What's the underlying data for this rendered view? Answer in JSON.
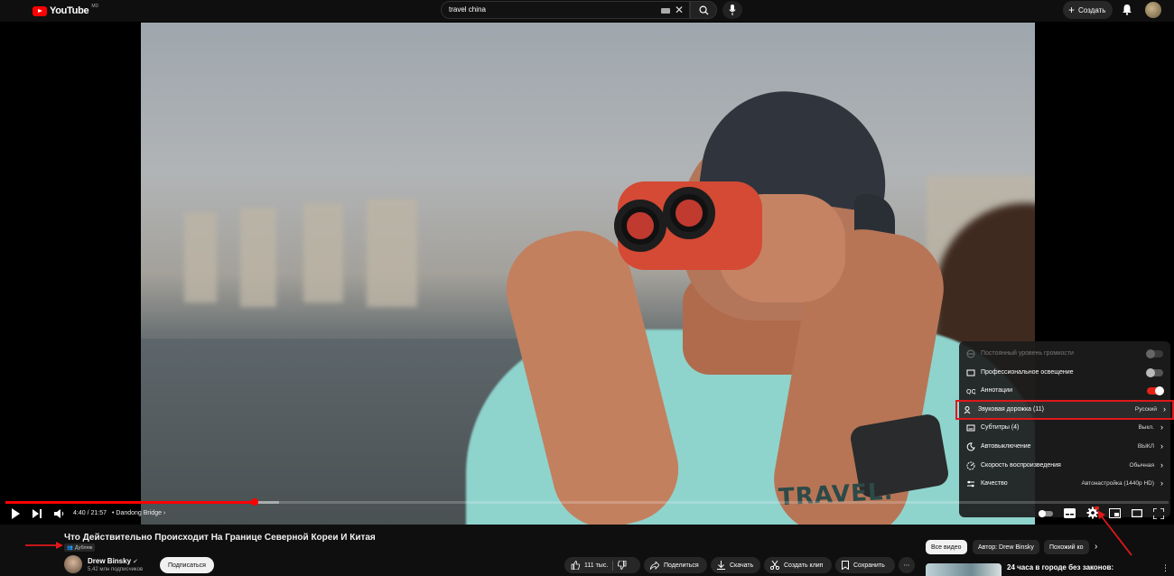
{
  "header": {
    "logo_text": "YouTube",
    "logo_region": "MD",
    "search_query": "travel china",
    "create_label": "Создать"
  },
  "player": {
    "progress_fraction": 0.214,
    "buffered_fraction": 0.235,
    "time_display": "4:40 / 21:57",
    "chapter": "• Dandong Bridge",
    "tee_print": "TRAVEL."
  },
  "settings_menu": {
    "items": [
      {
        "label": "Постоянный уровень громкости",
        "type": "toggle",
        "state": "disabled"
      },
      {
        "label": "Профессиональное освещение",
        "type": "toggle",
        "state": "off"
      },
      {
        "label": "Аннотации",
        "type": "toggle",
        "state": "on"
      },
      {
        "label": "Звуковая дорожка (11)",
        "type": "submenu",
        "value": "Русский",
        "highlighted": true
      },
      {
        "label": "Субтитры (4)",
        "type": "submenu",
        "value": "Выкл."
      },
      {
        "label": "Автовыключение",
        "type": "submenu",
        "value": "ВЫКЛ"
      },
      {
        "label": "Скорость воспроизведения",
        "type": "submenu",
        "value": "Обычная"
      },
      {
        "label": "Качество",
        "type": "submenu",
        "value": "Автонастройка (1440p HD)"
      }
    ]
  },
  "video": {
    "title": "Что Действительно Происходит На Границе Северной Кореи И Китая",
    "dub_badge": "Дубляж",
    "channel_name": "Drew Binsky",
    "subscribers": "5,42 млн подписчиков",
    "subscribe_label": "Подписаться"
  },
  "actions": {
    "likes": "111 тыс.",
    "share": "Поделиться",
    "download": "Скачать",
    "clip": "Создать клип",
    "save": "Сохранить",
    "more": "⋯"
  },
  "chips": [
    "Все видео",
    "Автор: Drew Binsky",
    "Похожий ко"
  ],
  "recommendation": {
    "title": "24 часа в городе без законов:",
    "more": "⋮"
  },
  "colors": {
    "accent": "#ff0000",
    "highlight_outline": "#e0181b",
    "toggle_on": "#e62117",
    "background": "#0f0f0f"
  }
}
